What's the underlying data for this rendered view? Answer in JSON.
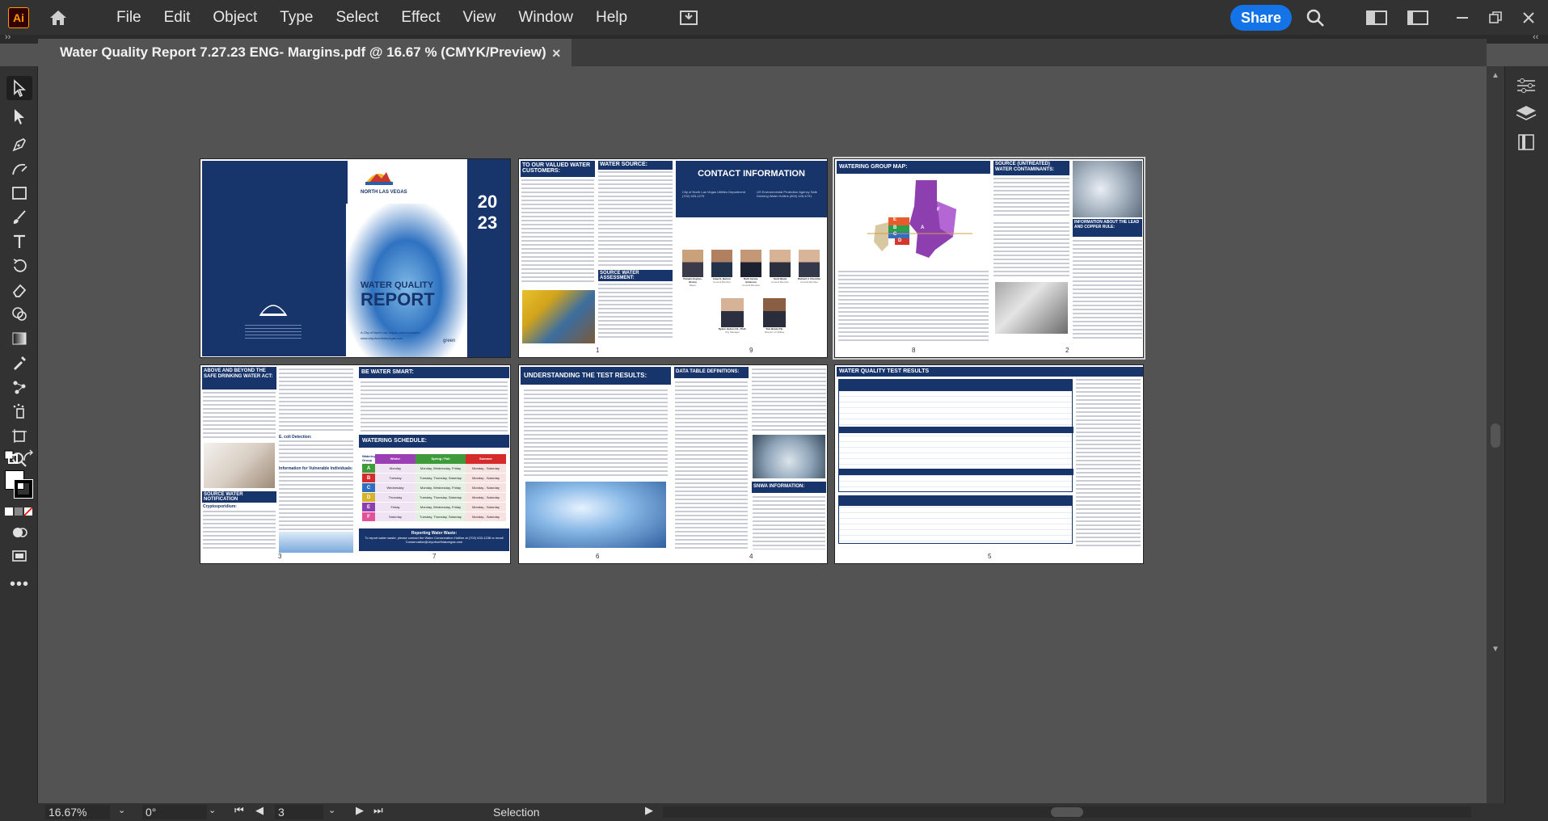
{
  "app": {
    "logo_text": "Ai",
    "menus": [
      "File",
      "Edit",
      "Object",
      "Type",
      "Select",
      "Effect",
      "View",
      "Window",
      "Help"
    ],
    "share_label": "Share",
    "accent_color": "#1473e6"
  },
  "document_tab": {
    "title": "Water Quality Report 7.27.23 ENG- Margins.pdf @ 16.67 % (CMYK/Preview)",
    "close_glyph": "×"
  },
  "statusbar": {
    "zoom": "16.67%",
    "rotation": "0°",
    "artboard": "3",
    "tool": "Selection"
  },
  "artboards": {
    "cover": {
      "title_small": "WATER QUALITY",
      "title_big": "REPORT",
      "year": "2023",
      "city": "NORTH LAS VEGAS",
      "credit": "A City of North Las Vegas communication",
      "url": "www.cityofnorthlasvegas.com",
      "footer_logo": "green"
    },
    "spread2": {
      "h_valued": "TO OUR VALUED WATER CUSTOMERS:",
      "h_source": "WATER SOURCE:",
      "h_assessment": "SOURCE WATER ASSESSMENT:",
      "h_contact": "CONTACT INFORMATION",
      "contact_left": "City of North Las Vegas Utilities Department (702) 633-1275",
      "contact_right": "US Environmental Protection Agency Safe Drinking Water Hotline (800) 426-4791",
      "page_left": "1",
      "page_right": "9",
      "officials": [
        {
          "name": "Pamela Goynes-Brown",
          "title": "Mayor"
        },
        {
          "name": "Isaac E. Barron",
          "title": "Council Member"
        },
        {
          "name": "Ruth Garcia-Anderson",
          "title": "Council Member"
        },
        {
          "name": "Scott Black",
          "title": "Council Member"
        },
        {
          "name": "Richard J. Cherchio",
          "title": "Council Member"
        },
        {
          "name": "Ryann Juden J.D., Ph.D.",
          "title": "City Manager"
        },
        {
          "name": "Tom Brady P.E.",
          "title": "Director of Utilities"
        }
      ]
    },
    "spread3": {
      "h_map": "WATERING GROUP MAP:",
      "h_contaminants": "SOURCE (UNTREATED) WATER CONTAMINANTS:",
      "h_lead": "INFORMATION ABOUT THE LEAD AND COPPER RULE:",
      "map_groups": [
        "A",
        "B",
        "C",
        "D",
        "E",
        "F"
      ],
      "page_left": "8",
      "page_right": "2"
    },
    "spread4": {
      "h_above": "ABOVE AND BEYOND THE SAFE DRINKING WATER ACT:",
      "h_notification": "SOURCE WATER NOTIFICATION",
      "h_crypto": "Cryptosporidium:",
      "h_ecoli": "E. coli Detection:",
      "h_vulnerable": "Information for Vulnerable Individuals:",
      "h_smart": "BE WATER SMART:",
      "h_schedule": "WATERING SCHEDULE:",
      "schedule_headers": [
        "Watering Group",
        "Winter",
        "Spring / Fall",
        "Summer"
      ],
      "schedule_rows": [
        {
          "group": "A",
          "winter": "Monday",
          "springfall": "Monday, Wednesday, Friday",
          "summer": "Monday - Saturday"
        },
        {
          "group": "B",
          "winter": "Tuesday",
          "springfall": "Tuesday, Thursday, Saturday",
          "summer": "Monday - Saturday"
        },
        {
          "group": "C",
          "winter": "Wednesday",
          "springfall": "Monday, Wednesday, Friday",
          "summer": "Monday - Saturday"
        },
        {
          "group": "D",
          "winter": "Thursday",
          "springfall": "Tuesday, Thursday, Saturday",
          "summer": "Monday - Saturday"
        },
        {
          "group": "E",
          "winter": "Friday",
          "springfall": "Monday, Wednesday, Friday",
          "summer": "Monday - Saturday"
        },
        {
          "group": "F",
          "winter": "Saturday",
          "springfall": "Tuesday, Thursday, Saturday",
          "summer": "Monday - Saturday"
        }
      ],
      "waste_title": "Reporting Water Waste:",
      "waste_text": "To report water waste, please contact the Water Conservation Hotline at (702) 633-1238 or email Conservation@cityofnorthlasvegas.com",
      "page_left": "3",
      "page_right": "7"
    },
    "spread5": {
      "h_understanding": "UNDERSTANDING THE TEST RESULTS:",
      "h_definitions": "DATA TABLE DEFINITIONS:",
      "h_snwa": "SNWA INFORMATION:",
      "page_left": "6",
      "page_right": "4"
    },
    "spread6": {
      "h_results": "WATER QUALITY TEST RESULTS",
      "page": "5"
    }
  },
  "colors": {
    "navy": "#17346b",
    "winter": "#9b3fb5",
    "springfall": "#3f9b3a",
    "summer": "#d62b2b"
  }
}
